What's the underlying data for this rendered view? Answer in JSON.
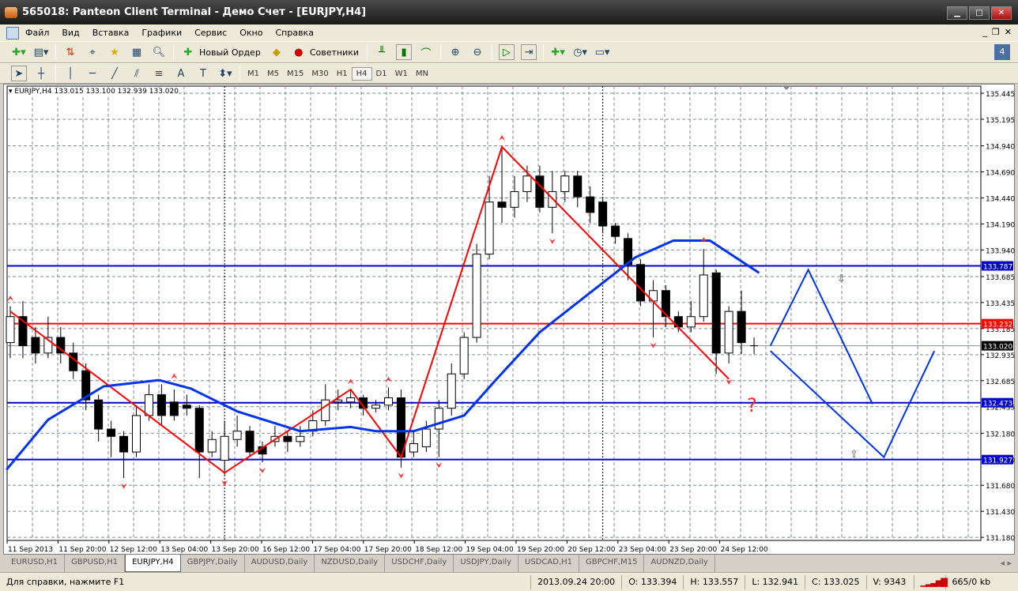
{
  "window": {
    "title": "565018: Panteon Client Terminal - Демо Счет - [EURJPY,H4]"
  },
  "menu": [
    "Файл",
    "Вид",
    "Вставка",
    "Графики",
    "Сервис",
    "Окно",
    "Справка"
  ],
  "toolbar": {
    "new_order": "Новый Ордер",
    "advisors": "Советники"
  },
  "timeframes": [
    "M1",
    "M5",
    "M15",
    "M30",
    "H1",
    "H4",
    "D1",
    "W1",
    "MN"
  ],
  "active_timeframe": "H4",
  "chart": {
    "header": "EURJPY,H4  133.015 133.100 132.939 133.020",
    "price_ticks": [
      "135.445",
      "135.195",
      "134.940",
      "134.690",
      "134.440",
      "134.190",
      "133.940",
      "133.685",
      "133.435",
      "133.185",
      "132.935",
      "132.685",
      "132.435",
      "132.180",
      "131.930",
      "131.680",
      "131.430",
      "131.180"
    ],
    "time_labels": [
      "11 Sep 2013",
      "11 Sep 20:00",
      "12 Sep 12:00",
      "13 Sep 04:00",
      "13 Sep 20:00",
      "16 Sep 12:00",
      "17 Sep 04:00",
      "17 Sep 20:00",
      "18 Sep 12:00",
      "19 Sep 04:00",
      "19 Sep 20:00",
      "20 Sep 12:00",
      "23 Sep 04:00",
      "23 Sep 20:00",
      "24 Sep 12:00"
    ],
    "hlines": [
      {
        "price": 133.787,
        "label": "133.787",
        "color": "#0000cc"
      },
      {
        "price": 133.232,
        "label": "133.232",
        "color": "#ff0000"
      },
      {
        "price": 132.473,
        "label": "132.473",
        "color": "#0000cc"
      },
      {
        "price": 131.927,
        "label": "131.927",
        "color": "#0000cc"
      }
    ],
    "bid": {
      "price": 133.02,
      "label": "133.020"
    },
    "annotation": "?",
    "candles": [
      [
        133.05,
        133.4,
        132.9,
        133.3
      ],
      [
        133.3,
        133.45,
        132.9,
        133.02
      ],
      [
        133.1,
        133.2,
        132.85,
        132.95
      ],
      [
        132.95,
        133.3,
        132.9,
        133.1
      ],
      [
        133.1,
        133.2,
        132.85,
        132.95
      ],
      [
        132.95,
        133.05,
        132.7,
        132.78
      ],
      [
        132.78,
        132.85,
        132.4,
        132.5
      ],
      [
        132.5,
        132.55,
        132.1,
        132.22
      ],
      [
        132.22,
        132.3,
        131.95,
        132.15
      ],
      [
        132.15,
        132.2,
        131.75,
        132.0
      ],
      [
        132.0,
        132.45,
        131.95,
        132.35
      ],
      [
        132.35,
        132.65,
        132.3,
        132.55
      ],
      [
        132.55,
        132.65,
        132.25,
        132.35
      ],
      [
        132.48,
        132.6,
        132.3,
        132.35
      ],
      [
        132.45,
        132.55,
        132.35,
        132.42
      ],
      [
        132.42,
        132.45,
        131.75,
        132.0
      ],
      [
        132.0,
        132.2,
        131.95,
        132.12
      ],
      [
        131.92,
        132.3,
        131.78,
        132.15
      ],
      [
        132.12,
        132.35,
        132.05,
        132.2
      ],
      [
        132.2,
        132.25,
        131.95,
        132.0
      ],
      [
        132.05,
        132.1,
        131.9,
        131.98
      ],
      [
        132.1,
        132.25,
        132.05,
        132.15
      ],
      [
        132.15,
        132.2,
        132.0,
        132.1
      ],
      [
        132.1,
        132.25,
        132.05,
        132.15
      ],
      [
        132.2,
        132.4,
        132.15,
        132.3
      ],
      [
        132.3,
        132.65,
        132.25,
        132.5
      ],
      [
        132.48,
        132.6,
        132.4,
        132.5
      ],
      [
        132.48,
        132.6,
        132.42,
        132.52
      ],
      [
        132.52,
        132.55,
        132.35,
        132.42
      ],
      [
        132.42,
        132.5,
        132.38,
        132.45
      ],
      [
        132.45,
        132.62,
        132.4,
        132.52
      ],
      [
        132.52,
        132.6,
        131.85,
        131.95
      ],
      [
        132.0,
        132.2,
        131.95,
        132.08
      ],
      [
        132.05,
        132.3,
        132.0,
        132.22
      ],
      [
        132.22,
        132.5,
        131.95,
        132.42
      ],
      [
        132.42,
        132.85,
        132.35,
        132.75
      ],
      [
        132.75,
        133.15,
        132.7,
        133.1
      ],
      [
        133.1,
        134.0,
        133.05,
        133.9
      ],
      [
        133.9,
        134.65,
        133.85,
        134.4
      ],
      [
        134.4,
        134.94,
        134.2,
        134.35
      ],
      [
        134.35,
        134.65,
        134.25,
        134.5
      ],
      [
        134.5,
        134.75,
        134.4,
        134.65
      ],
      [
        134.65,
        134.75,
        134.3,
        134.35
      ],
      [
        134.35,
        134.7,
        134.1,
        134.5
      ],
      [
        134.5,
        134.7,
        134.4,
        134.65
      ],
      [
        134.65,
        134.7,
        134.35,
        134.45
      ],
      [
        134.45,
        134.55,
        134.2,
        134.3
      ],
      [
        134.4,
        134.45,
        134.1,
        134.17
      ],
      [
        134.17,
        134.2,
        134.0,
        134.07
      ],
      [
        134.05,
        134.1,
        133.65,
        133.8
      ],
      [
        133.8,
        133.85,
        133.4,
        133.45
      ],
      [
        133.45,
        133.65,
        133.1,
        133.55
      ],
      [
        133.55,
        133.6,
        133.2,
        133.3
      ],
      [
        133.3,
        133.35,
        133.15,
        133.2
      ],
      [
        133.2,
        133.45,
        133.15,
        133.3
      ],
      [
        133.3,
        133.95,
        133.25,
        133.7
      ],
      [
        133.72,
        133.75,
        132.75,
        132.95
      ],
      [
        132.95,
        133.4,
        132.85,
        133.35
      ],
      [
        133.35,
        133.55,
        132.94,
        133.05
      ],
      [
        133.015,
        133.1,
        132.939,
        133.02
      ]
    ],
    "zigzag": [
      [
        0,
        133.35
      ],
      [
        17,
        131.8
      ],
      [
        27,
        132.6
      ],
      [
        31,
        131.95
      ],
      [
        39,
        134.93
      ],
      [
        57,
        132.7
      ]
    ],
    "ma": [
      [
        -0.3,
        131.83
      ],
      [
        3,
        132.31
      ],
      [
        7.4,
        132.63
      ],
      [
        11.8,
        132.69
      ],
      [
        14.3,
        132.61
      ],
      [
        18,
        132.39
      ],
      [
        23,
        132.2
      ],
      [
        27,
        132.24
      ],
      [
        29,
        132.2
      ],
      [
        32,
        132.2
      ],
      [
        36,
        132.35
      ],
      [
        38.5,
        132.69
      ],
      [
        42,
        133.15
      ],
      [
        46,
        133.53
      ],
      [
        49.6,
        133.87
      ],
      [
        52.6,
        134.03
      ],
      [
        55.5,
        134.03
      ],
      [
        59.4,
        133.72
      ]
    ],
    "forecast": [
      [
        [
          60.3,
          133.02
        ],
        [
          63.3,
          133.75
        ],
        [
          68.4,
          132.46
        ]
      ],
      [
        [
          60.3,
          132.97
        ],
        [
          69.3,
          131.95
        ],
        [
          73.3,
          132.97
        ]
      ]
    ],
    "fractals_up": [
      [
        0,
        133.45
      ],
      [
        13,
        132.7
      ],
      [
        27,
        132.65
      ],
      [
        30,
        132.67
      ],
      [
        39,
        134.99
      ],
      [
        55,
        134.01
      ]
    ],
    "fractals_down": [
      [
        9,
        131.7
      ],
      [
        17,
        131.73
      ],
      [
        20,
        131.85
      ],
      [
        31,
        131.8
      ],
      [
        34,
        131.9
      ],
      [
        43,
        134.05
      ],
      [
        51,
        133.05
      ],
      [
        57,
        132.7
      ]
    ]
  },
  "tabs": [
    "EURUSD,H1",
    "GBPUSD,H1",
    "EURJPY,H4",
    "GBPJPY,Daily",
    "AUDUSD,Daily",
    "NZDUSD,Daily",
    "USDCHF,Daily",
    "USDJPY,Daily",
    "USDCAD,H1",
    "GBPCHF,M15",
    "AUDNZD,Daily"
  ],
  "active_tab": "EURJPY,H4",
  "status": {
    "help": "Для справки, нажмите F1",
    "datetime": "2013.09.24 20:00",
    "open": "O: 133.394",
    "high": "H: 133.557",
    "low": "L: 132.941",
    "close": "C: 133.025",
    "volume": "V: 9343",
    "traffic": "665/0 kb"
  }
}
